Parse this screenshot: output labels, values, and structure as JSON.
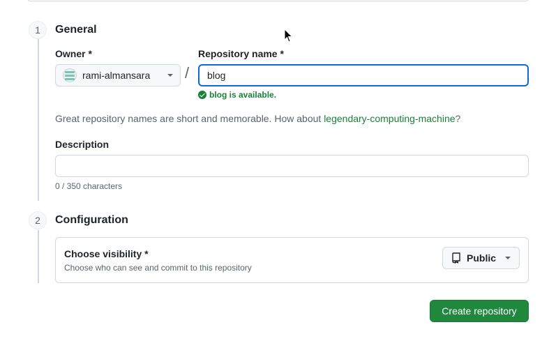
{
  "steps": {
    "general": {
      "number": "1",
      "title": "General"
    },
    "configuration": {
      "number": "2",
      "title": "Configuration"
    }
  },
  "owner": {
    "label": "Owner *",
    "name": "rami-almansara"
  },
  "separator": "/",
  "repository": {
    "label": "Repository name *",
    "value": "blog",
    "availability": "blog is available."
  },
  "hint": {
    "prefix": "Great repository names are short and memorable. How about ",
    "suggestion": "legendary-computing-machine",
    "suffix": "?"
  },
  "description": {
    "label": "Description",
    "value": "",
    "char_count": "0 / 350 characters"
  },
  "visibility": {
    "title": "Choose visibility *",
    "subtitle": "Choose who can see and commit to this repository",
    "selected": "Public"
  },
  "actions": {
    "create_label": "Create repository"
  },
  "colors": {
    "accent_green": "#1f883d",
    "focus_blue": "#0969da",
    "success_text": "#1a7f37"
  }
}
